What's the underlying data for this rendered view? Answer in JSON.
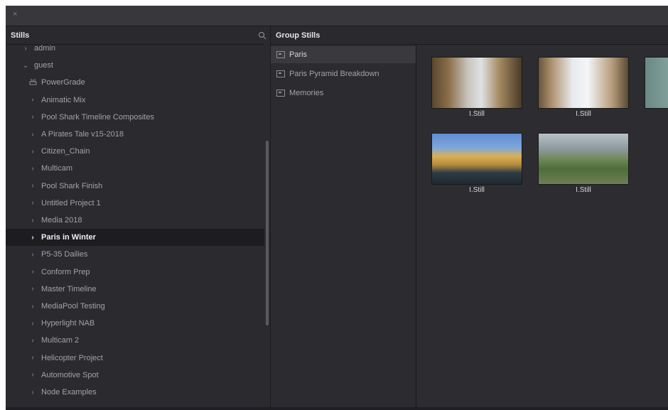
{
  "window": {
    "close_glyph": "×"
  },
  "left_panel": {
    "title": "Stills",
    "search_icon": "search-icon"
  },
  "right_panel": {
    "title": "Group Stills"
  },
  "tree": [
    {
      "label": "admin",
      "chevron": "›",
      "indent": 0,
      "selected": false
    },
    {
      "label": "guest",
      "chevron": "⌄",
      "indent": 0,
      "selected": false
    },
    {
      "label": "PowerGrade",
      "chevron": "",
      "indent": 1,
      "selected": false,
      "icon": "powergrade-icon"
    },
    {
      "label": "Animatic Mix",
      "chevron": "›",
      "indent": 1,
      "selected": false
    },
    {
      "label": "Pool Shark Timeline Composites",
      "chevron": "›",
      "indent": 1,
      "selected": false
    },
    {
      "label": "A Pirates Tale v15-2018",
      "chevron": "›",
      "indent": 1,
      "selected": false
    },
    {
      "label": "Citizen_Chain",
      "chevron": "›",
      "indent": 1,
      "selected": false
    },
    {
      "label": "Multicam",
      "chevron": "›",
      "indent": 1,
      "selected": false
    },
    {
      "label": "Pool Shark Finish",
      "chevron": "›",
      "indent": 1,
      "selected": false
    },
    {
      "label": "Untitled Project 1",
      "chevron": "›",
      "indent": 1,
      "selected": false
    },
    {
      "label": "Media 2018",
      "chevron": "›",
      "indent": 1,
      "selected": false
    },
    {
      "label": "Paris in Winter",
      "chevron": "›",
      "indent": 1,
      "selected": true
    },
    {
      "label": "P5-35 Dailies",
      "chevron": "›",
      "indent": 1,
      "selected": false
    },
    {
      "label": "Conform Prep",
      "chevron": "›",
      "indent": 1,
      "selected": false
    },
    {
      "label": "Master Timeline",
      "chevron": "›",
      "indent": 1,
      "selected": false
    },
    {
      "label": "MediaPool Testing",
      "chevron": "›",
      "indent": 1,
      "selected": false
    },
    {
      "label": "Hyperlight NAB",
      "chevron": "›",
      "indent": 1,
      "selected": false
    },
    {
      "label": "Multicam 2",
      "chevron": "›",
      "indent": 1,
      "selected": false
    },
    {
      "label": "Helicopter Project",
      "chevron": "›",
      "indent": 1,
      "selected": false
    },
    {
      "label": "Automotive Spot",
      "chevron": "›",
      "indent": 1,
      "selected": false
    },
    {
      "label": "Node Examples",
      "chevron": "›",
      "indent": 1,
      "selected": false
    }
  ],
  "groups": [
    {
      "label": "Paris",
      "active": true
    },
    {
      "label": "Paris Pyramid Breakdown",
      "active": false
    },
    {
      "label": "Memories",
      "active": false
    }
  ],
  "stills": [
    {
      "label": "I.Still",
      "image": "eiffel-tower-street-still"
    },
    {
      "label": "I.Still",
      "image": "eiffel-tower-bright-still"
    },
    {
      "label": "",
      "image": "partial-still"
    },
    {
      "label": "I.Still",
      "image": "paris-bridge-still"
    },
    {
      "label": "I.Still",
      "image": "champ-de-mars-aerial-still"
    }
  ],
  "colors": {
    "background": "#2b2b2f",
    "selected_row": "#1d1d20",
    "active_group": "#3a3a3e"
  }
}
